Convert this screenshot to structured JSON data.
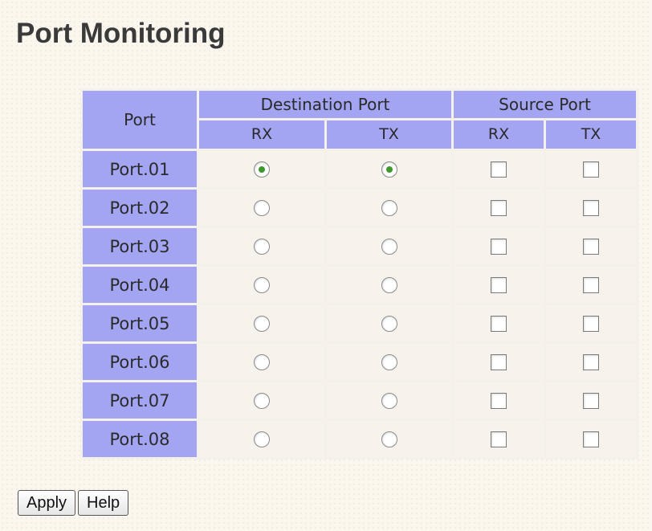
{
  "title": "Port Monitoring",
  "table": {
    "port_header": "Port",
    "destination_header": "Destination Port",
    "source_header": "Source Port",
    "rx_label": "RX",
    "tx_label": "TX",
    "rows": [
      {
        "port": "Port.01",
        "dest_rx": true,
        "dest_tx": true,
        "src_rx": false,
        "src_tx": false
      },
      {
        "port": "Port.02",
        "dest_rx": false,
        "dest_tx": false,
        "src_rx": false,
        "src_tx": false
      },
      {
        "port": "Port.03",
        "dest_rx": false,
        "dest_tx": false,
        "src_rx": false,
        "src_tx": false
      },
      {
        "port": "Port.04",
        "dest_rx": false,
        "dest_tx": false,
        "src_rx": false,
        "src_tx": false
      },
      {
        "port": "Port.05",
        "dest_rx": false,
        "dest_tx": false,
        "src_rx": false,
        "src_tx": false
      },
      {
        "port": "Port.06",
        "dest_rx": false,
        "dest_tx": false,
        "src_rx": false,
        "src_tx": false
      },
      {
        "port": "Port.07",
        "dest_rx": false,
        "dest_tx": false,
        "src_rx": false,
        "src_tx": false
      },
      {
        "port": "Port.08",
        "dest_rx": false,
        "dest_tx": false,
        "src_rx": false,
        "src_tx": false
      }
    ]
  },
  "buttons": {
    "apply": "Apply",
    "help": "Help"
  }
}
